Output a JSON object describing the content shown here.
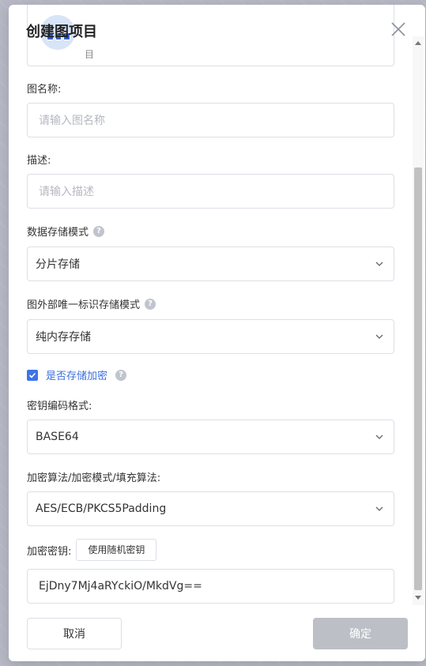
{
  "dialog": {
    "title": "创建图项目",
    "card_subtext": "目"
  },
  "form": {
    "graph_name_label": "图名称:",
    "graph_name_placeholder": "请输入图名称",
    "description_label": "描述:",
    "description_placeholder": "请输入描述",
    "storage_mode_label": "数据存储模式",
    "storage_mode_value": "分片存储",
    "external_id_label": "图外部唯一标识存储模式",
    "external_id_value": "纯内存存储",
    "encrypt_label": "是否存储加密",
    "encrypt_checked": true,
    "key_format_label": "密钥编码格式:",
    "key_format_value": "BASE64",
    "algorithm_label": "加密算法/加密模式/填充算法:",
    "algorithm_value": "AES/ECB/PKCS5Padding",
    "key_label": "加密密钥:",
    "random_key_button": "使用随机密钥",
    "key_value": "EjDny7Mj4aRYckiO/MkdVg=="
  },
  "footer": {
    "cancel_label": "取消",
    "confirm_label": "确定"
  },
  "icons": {
    "help": "question-circle-icon",
    "chevron": "chevron-down-icon",
    "close": "close-icon",
    "check": "check-icon"
  },
  "colors": {
    "accent": "#3d74e8",
    "disabled_button": "#bcc0c6"
  }
}
